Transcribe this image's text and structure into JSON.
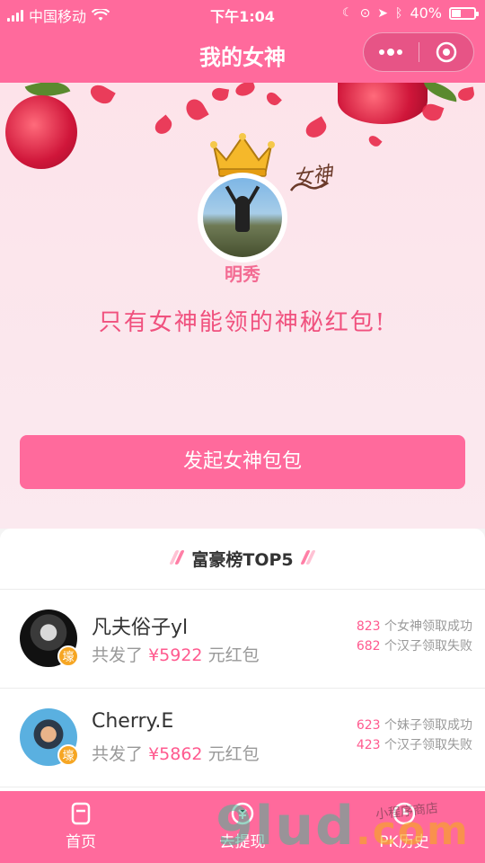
{
  "status_bar": {
    "carrier": "中国移动",
    "time": "下午1:04",
    "battery_percent": "40%",
    "battery_level": 0.4
  },
  "header": {
    "title": "我的女神"
  },
  "hero": {
    "tag": "女神",
    "name": "明秀",
    "slogan": "只有女神能领的神秘红包!"
  },
  "primary_button": "发起女神包包",
  "leaderboard": {
    "title": "富豪榜TOP5",
    "rows": [
      {
        "name": "凡夫俗子yl",
        "badge": "壕",
        "prefix": "共发了",
        "amount": "¥5922",
        "suffix": "元红包",
        "stat1_num": "823",
        "stat1_text": "个女神领取成功",
        "stat2_num": "682",
        "stat2_text": "个汉子领取失败"
      },
      {
        "name": "Cherry.E",
        "badge": "壕",
        "prefix": "共发了",
        "amount": "¥5862",
        "suffix": "元红包",
        "stat1_num": "623",
        "stat1_text": "个妹子领取成功",
        "stat2_num": "423",
        "stat2_text": "个汉子领取失败"
      }
    ]
  },
  "tabbar": {
    "tabs": [
      {
        "label": "首页",
        "icon": "home-icon"
      },
      {
        "label": "去提现",
        "icon": "wallet-icon"
      },
      {
        "label": "PK历史",
        "icon": "history-icon"
      }
    ]
  },
  "watermark": {
    "main": "9lud",
    "suffix": ".com",
    "sub": "小程序商店"
  },
  "colors": {
    "brand": "#ff6a9c",
    "accent": "#ff5a8f",
    "badge": "#f6a623"
  }
}
